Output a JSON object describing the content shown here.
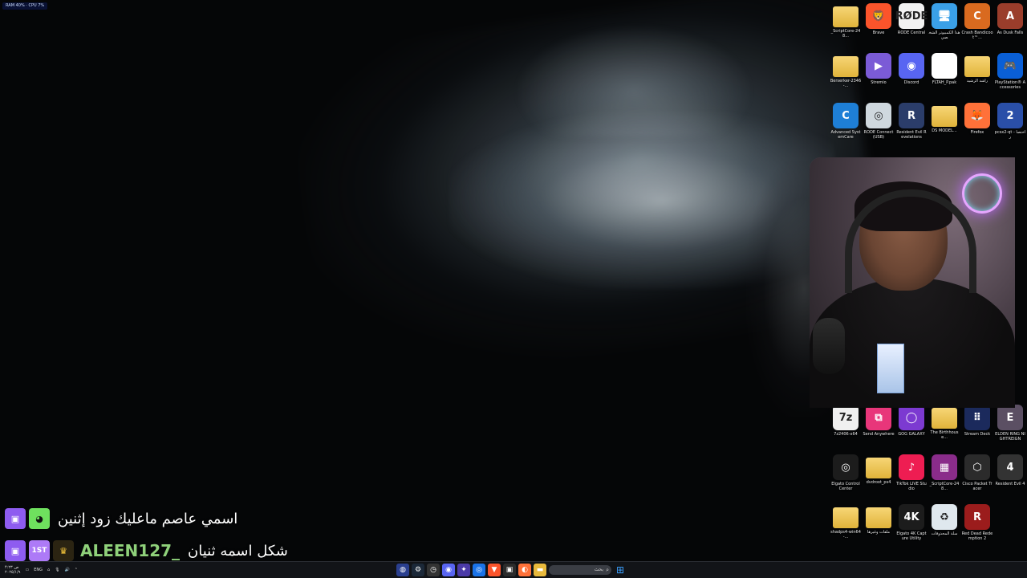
{
  "perf_overlay": "RAM 40% · CPU 7%",
  "desktop_icons": [
    {
      "id": "scriptcore-1",
      "label": "_ScriptCore-248...",
      "glyph": "",
      "color": "#e8b93c",
      "kind": "folder"
    },
    {
      "id": "brave",
      "label": "Brave",
      "glyph": "🦁",
      "color": "#fb542b",
      "kind": "app"
    },
    {
      "id": "rode-central",
      "label": "RODE Central",
      "glyph": "RØDE",
      "color": "#f2f2f2",
      "kind": "app"
    },
    {
      "id": "this-pc",
      "label": "هذا الكمبيوتر الشخصي",
      "glyph": "🖥",
      "color": "#3aa0e8",
      "kind": "app"
    },
    {
      "id": "crash",
      "label": "Crash Bandicoot™...",
      "glyph": "C",
      "color": "#d96a1f",
      "kind": "app"
    },
    {
      "id": "as-dusk-falls",
      "label": "As Dusk Falls",
      "glyph": "A",
      "color": "#9a3d2b",
      "kind": "app"
    },
    {
      "id": "berserker",
      "label": "Berserker-2346-...",
      "glyph": "",
      "color": "#e8b93c",
      "kind": "folder"
    },
    {
      "id": "stremio",
      "label": "Stremio",
      "glyph": "▶",
      "color": "#7b5bd6",
      "kind": "app"
    },
    {
      "id": "discord",
      "label": "Discord",
      "glyph": "◉",
      "color": "#5865f2",
      "kind": "app"
    },
    {
      "id": "fltah",
      "label": "FLTAH_P.pak",
      "glyph": "",
      "color": "#ffffff",
      "kind": "file"
    },
    {
      "id": "rashid",
      "label": "راشد الرشيد",
      "glyph": "",
      "color": "#e8b93c",
      "kind": "folder"
    },
    {
      "id": "ps-accessories",
      "label": "PlayStation® Accessories",
      "glyph": "🎮",
      "color": "#0a5fd6",
      "kind": "app"
    },
    {
      "id": "advanced-systemcare",
      "label": "Advanced SystemCare",
      "glyph": "C",
      "color": "#1e7fd6",
      "kind": "app"
    },
    {
      "id": "rode-connect",
      "label": "RODE Connect (USB)",
      "glyph": "◎",
      "color": "#cfd8de",
      "kind": "app"
    },
    {
      "id": "resident-evil-rev",
      "label": "Resident Evil Revelations",
      "glyph": "R",
      "color": "#2b3d6a",
      "kind": "app"
    },
    {
      "id": "ds-model",
      "label": "DS MODEL...",
      "glyph": "",
      "color": "#e8b93c",
      "kind": "folder"
    },
    {
      "id": "firefox",
      "label": "Firefox",
      "glyph": "🦊",
      "color": "#ff7139",
      "kind": "app"
    },
    {
      "id": "pcsx2",
      "label": "pcsx2-qt - اختصار",
      "glyph": "2",
      "color": "#2a4fa8",
      "kind": "app"
    },
    {
      "id": "7z",
      "label": "7z2406-x64",
      "glyph": "7z",
      "color": "#f0f0f0",
      "kind": "app"
    },
    {
      "id": "send-anywhere",
      "label": "Send Anywhere",
      "glyph": "⧉",
      "color": "#e8367a",
      "kind": "app"
    },
    {
      "id": "gog-galaxy",
      "label": "GOG GALAXY",
      "glyph": "◯",
      "color": "#7c3ad1",
      "kind": "app"
    },
    {
      "id": "the-birthhouse",
      "label": "The Birthhouse...",
      "glyph": "",
      "color": "#e8b93c",
      "kind": "folder"
    },
    {
      "id": "stream-deck",
      "label": "Stream Deck",
      "glyph": "⠿",
      "color": "#1b2a5c",
      "kind": "app"
    },
    {
      "id": "elden-ring",
      "label": "ELDEN RING NIGHTREIGN",
      "glyph": "E",
      "color": "#5b4f63",
      "kind": "app"
    },
    {
      "id": "elgato-cc",
      "label": "Elgato Control Center",
      "glyph": "◎",
      "color": "#1c1c1c",
      "kind": "app"
    },
    {
      "id": "dvdroot",
      "label": "dvdroot_ps4",
      "glyph": "",
      "color": "#e8b93c",
      "kind": "folder"
    },
    {
      "id": "tiktok-live",
      "label": "TikTok LIVE Studio",
      "glyph": "♪",
      "color": "#ee1d52",
      "kind": "app"
    },
    {
      "id": "scriptcore-2",
      "label": "_ScriptCore-248...",
      "glyph": "▦",
      "color": "#8a2c8a",
      "kind": "app"
    },
    {
      "id": "cisco-pt",
      "label": "Cisco Packet Tracer",
      "glyph": "⬡",
      "color": "#2b2b2b",
      "kind": "app"
    },
    {
      "id": "re4",
      "label": "Resident Evil 4",
      "glyph": "4",
      "color": "#333333",
      "kind": "app"
    },
    {
      "id": "shadps4",
      "label": "shadps4-win64-...",
      "glyph": "",
      "color": "#e8b93c",
      "kind": "folder"
    },
    {
      "id": "files-misc",
      "label": "ملفات وغيرها",
      "glyph": "",
      "color": "#e8b93c",
      "kind": "folder"
    },
    {
      "id": "elgato-4k",
      "label": "Elgato 4K Capture Utility",
      "glyph": "4K",
      "color": "#1c1c1c",
      "kind": "app"
    },
    {
      "id": "recycle-bin",
      "label": "سلة المحذوفات",
      "glyph": "♻",
      "color": "#dfe8ee",
      "kind": "app"
    },
    {
      "id": "rdr2",
      "label": "Red Dead Redemption 2",
      "glyph": "R",
      "color": "#9b1c1c",
      "kind": "app"
    }
  ],
  "chat": [
    {
      "user": "",
      "message": "اسمي عاصم ماعليك زود إثنين",
      "badges": [
        "twitch",
        "cat"
      ]
    },
    {
      "user": "ALEEN127_",
      "message": "شكل اسمه ثنيان",
      "badges": [
        "twitch",
        "first",
        "crown"
      ]
    }
  ],
  "taskbar": {
    "tray_time": "۴:۲۳ ص",
    "tray_date": "۲۰۲۵/۱/۹",
    "language": "ENG",
    "search_placeholder": "بحث"
  }
}
